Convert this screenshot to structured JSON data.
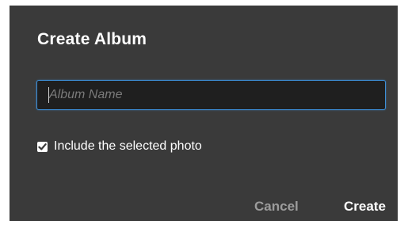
{
  "dialog": {
    "title": "Create Album",
    "album_name": {
      "value": "",
      "placeholder": "Album Name"
    },
    "include_selected": {
      "checked": true,
      "label": "Include the selected photo"
    },
    "buttons": {
      "cancel_label": "Cancel",
      "create_label": "Create"
    }
  },
  "colors": {
    "dialog_background": "#3a3a3a",
    "input_background": "#1f1f1f",
    "focus_border": "#3d8fd8",
    "primary_text": "#ffffff",
    "secondary_text": "#9c9c9c"
  },
  "icons": {
    "checkbox": "checkmark-icon"
  }
}
